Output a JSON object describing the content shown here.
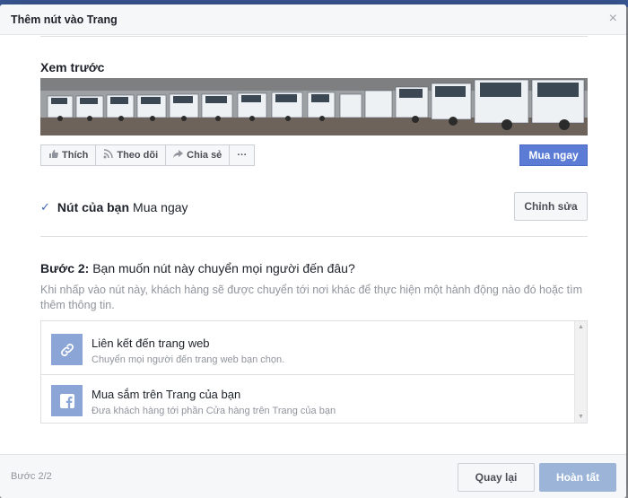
{
  "dialog": {
    "title": "Thêm nút vào Trang",
    "close_label": "×"
  },
  "preview": {
    "label": "Xem trước",
    "cover_image": "cover-photo-trucks",
    "actions": [
      {
        "icon": "thumbs-up-icon",
        "label": "Thích"
      },
      {
        "icon": "rss-icon",
        "label": "Theo dõi"
      },
      {
        "icon": "share-arrow-icon",
        "label": "Chia sẻ"
      },
      {
        "icon": "more-icon",
        "label": "···"
      }
    ],
    "cta_button": "Mua ngay"
  },
  "your_button": {
    "check": "✓",
    "label": "Nút của bạn",
    "value": "Mua ngay",
    "edit": "Chỉnh sửa"
  },
  "step": {
    "label": "Bước 2:",
    "question": "Bạn muốn nút này chuyển mọi người đến đâu?",
    "description": "Khi nhấp vào nút này, khách hàng sẽ được chuyển tới nơi khác để thực hiện một hành động nào đó hoặc tìm thêm thông tin."
  },
  "options": [
    {
      "icon": "link-icon",
      "title": "Liên kết đến trang web",
      "subtitle": "Chuyển mọi người đến trang web bạn chọn."
    },
    {
      "icon": "facebook-icon",
      "title": "Mua sắm trên Trang của bạn",
      "subtitle": "Đưa khách hàng tới phần Cửa hàng trên Trang của bạn"
    }
  ],
  "footer": {
    "step_count": "Bước 2/2",
    "back": "Quay lại",
    "done": "Hoàn tất"
  },
  "colors": {
    "accent": "#5b7bd5",
    "done_disabled": "#9cb4d8",
    "icon_bg": "#8ba5d6",
    "check": "#4267b2"
  }
}
